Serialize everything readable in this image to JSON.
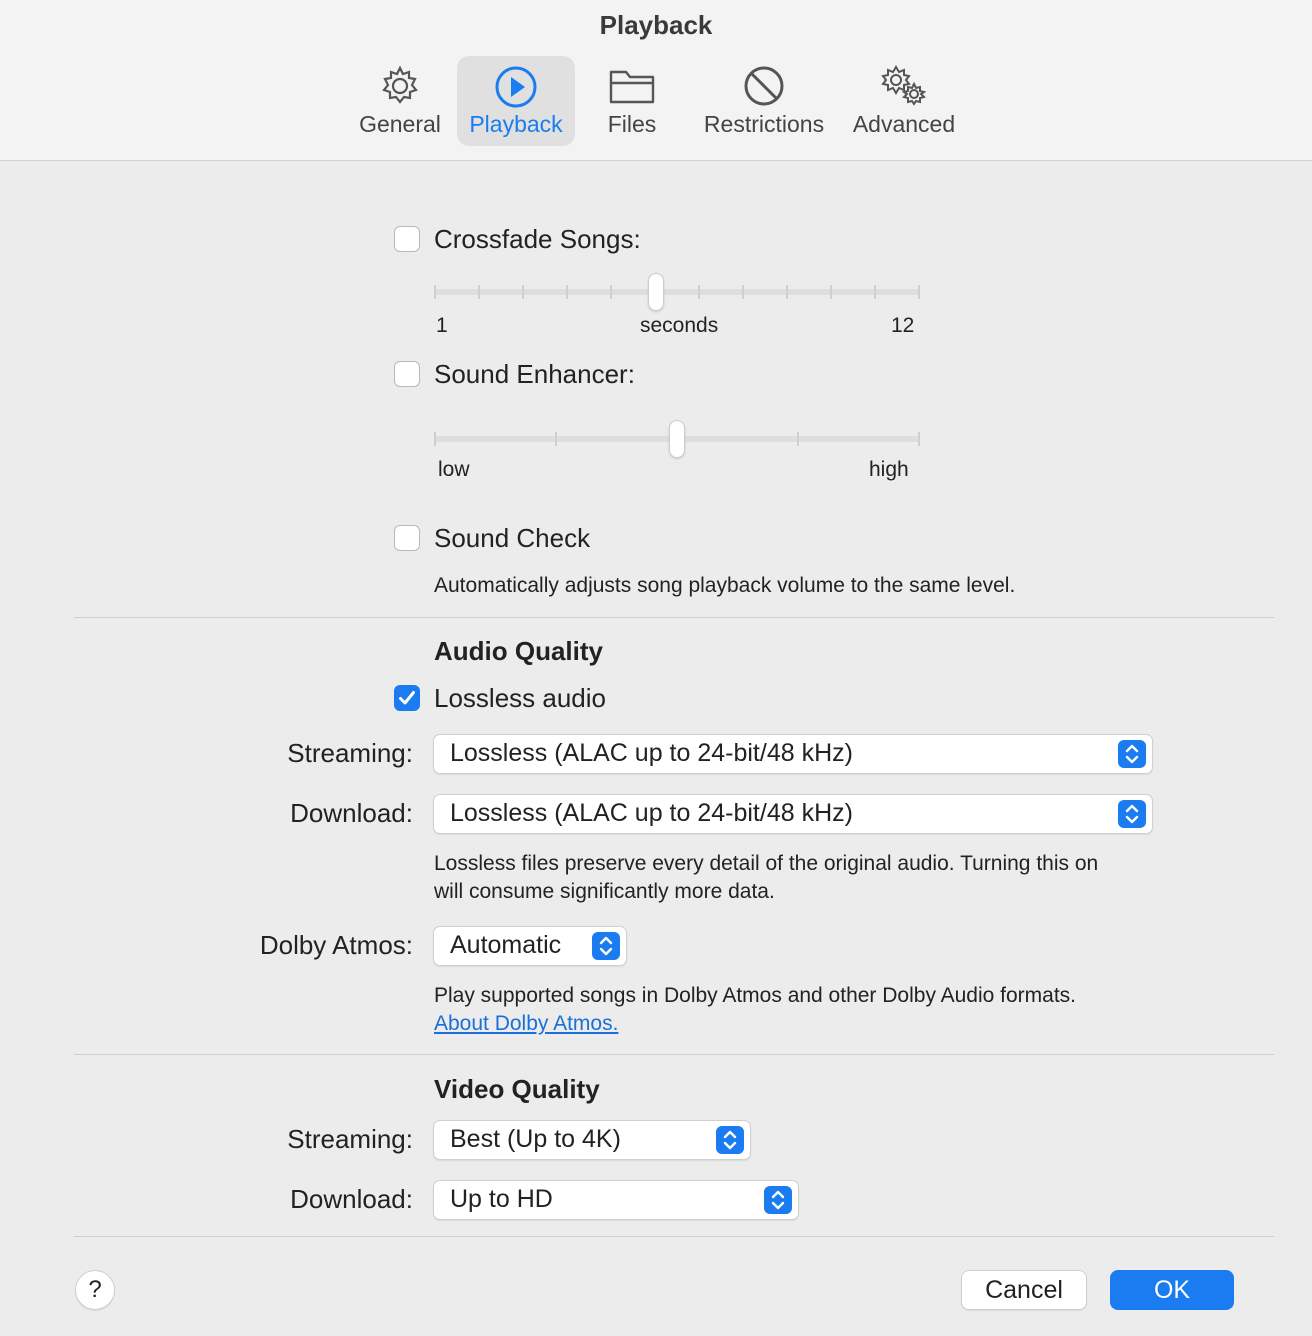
{
  "window": {
    "title": "Playback"
  },
  "tabs": [
    {
      "label": "General",
      "icon": "gear-icon",
      "active": false
    },
    {
      "label": "Playback",
      "icon": "play-circle-icon",
      "active": true
    },
    {
      "label": "Files",
      "icon": "folder-icon",
      "active": false
    },
    {
      "label": "Restrictions",
      "icon": "prohibited-icon",
      "active": false
    },
    {
      "label": "Advanced",
      "icon": "gears-icon",
      "active": false
    }
  ],
  "crossfade": {
    "label": "Crossfade Songs:",
    "checked": false,
    "min_label": "1",
    "unit_label": "seconds",
    "max_label": "12",
    "min": 1,
    "max": 12,
    "value": 6
  },
  "sound_enhancer": {
    "label": "Sound Enhancer:",
    "checked": false,
    "min_label": "low",
    "max_label": "high",
    "level": 0.5
  },
  "sound_check": {
    "label": "Sound Check",
    "checked": false,
    "description": "Automatically adjusts song playback volume to the same level."
  },
  "audio_quality": {
    "heading": "Audio Quality",
    "lossless_label": "Lossless audio",
    "lossless_checked": true,
    "streaming_label": "Streaming:",
    "streaming_value": "Lossless (ALAC up to 24-bit/48 kHz)",
    "download_label": "Download:",
    "download_value": "Lossless (ALAC up to 24-bit/48 kHz)",
    "note_line1": "Lossless files preserve every detail of the original audio. Turning this on",
    "note_line2": "will consume significantly more data.",
    "dolby_label": "Dolby Atmos:",
    "dolby_value": "Automatic",
    "dolby_note": "Play supported songs in Dolby Atmos and other Dolby Audio formats.",
    "dolby_link": "About Dolby Atmos."
  },
  "video_quality": {
    "heading": "Video Quality",
    "streaming_label": "Streaming:",
    "streaming_value": "Best (Up to 4K)",
    "download_label": "Download:",
    "download_value": "Up to HD"
  },
  "footer": {
    "help_label": "?",
    "cancel_label": "Cancel",
    "ok_label": "OK"
  },
  "colors": {
    "accent": "#1a7cf0",
    "link": "#1a6fd8",
    "background": "#ececec"
  }
}
